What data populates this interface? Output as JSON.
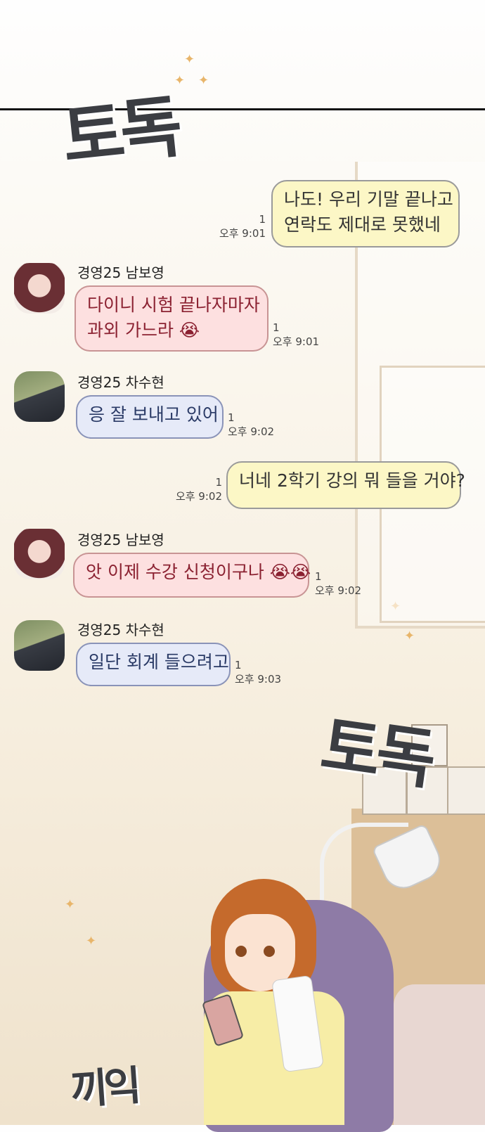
{
  "sfx": {
    "top": "토독",
    "middle": "토독",
    "bottom": "끼익"
  },
  "messages": [
    {
      "from": "me",
      "text_lines": [
        "나도! 우리 기말 끝나고",
        "연락도 제대로 못했네"
      ],
      "unread": "1",
      "time": "오후 9:01"
    },
    {
      "from": "경영25 남보영",
      "text_lines": [
        "다이니 시험 끝나자마자",
        "과외 가느라 😭"
      ],
      "unread": "1",
      "time": "오후 9:01"
    },
    {
      "from": "경영25 차수현",
      "text_lines": [
        "응 잘 보내고 있어"
      ],
      "unread": "1",
      "time": "오후 9:02"
    },
    {
      "from": "me",
      "text_lines": [
        "너네 2학기 강의 뭐 들을 거야?"
      ],
      "unread": "1",
      "time": "오후 9:02"
    },
    {
      "from": "경영25 남보영",
      "text_lines": [
        "앗 이제 수강 신청이구나 😭😭"
      ],
      "unread": "1",
      "time": "오후 9:02"
    },
    {
      "from": "경영25 차수현",
      "text_lines": [
        "일단 회계 들으려고"
      ],
      "unread": "1",
      "time": "오후 9:03"
    }
  ],
  "icons": {
    "avatar_girl": "avatar-girl-icon",
    "avatar_boy": "avatar-boy-icon"
  },
  "colors": {
    "me_bubble": "#fcf7c6",
    "pink_bubble": "#fde0e0",
    "blue_bubble": "#e6eaf8"
  }
}
